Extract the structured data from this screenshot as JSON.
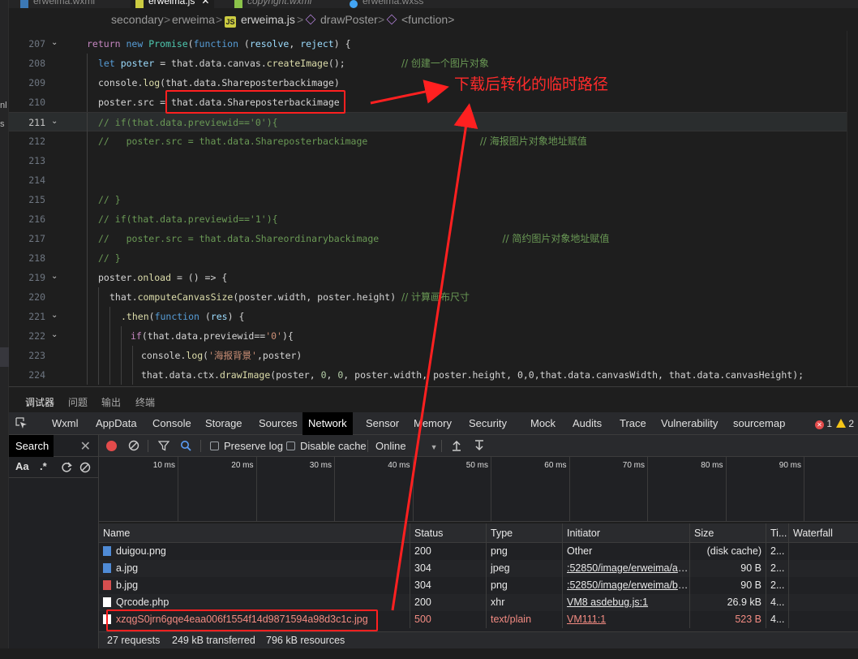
{
  "tabs": [
    {
      "label": "erweima.wxml",
      "active": false
    },
    {
      "label": "erweima.js",
      "active": true
    },
    {
      "label": "copyright.wxml",
      "active": false
    },
    {
      "label": "erweima.wxss",
      "active": false
    }
  ],
  "breadcrumb": {
    "seg1": "secondary",
    "seg2": "erweima",
    "file": "erweima.js",
    "fn1": "drawPoster",
    "fn2": "<function>",
    "js_badge": "JS",
    "sep": ">"
  },
  "left_fragments": [
    "nl",
    "s"
  ],
  "editor": {
    "lines": [
      {
        "n": "207",
        "fold": true
      },
      {
        "n": "208",
        "fold": false
      },
      {
        "n": "209",
        "fold": false
      },
      {
        "n": "210",
        "fold": false
      },
      {
        "n": "211",
        "fold": true,
        "current": true
      },
      {
        "n": "212",
        "fold": false
      },
      {
        "n": "213",
        "fold": false
      },
      {
        "n": "214",
        "fold": false
      },
      {
        "n": "215",
        "fold": false
      },
      {
        "n": "216",
        "fold": false
      },
      {
        "n": "217",
        "fold": false
      },
      {
        "n": "218",
        "fold": false
      },
      {
        "n": "219",
        "fold": true
      },
      {
        "n": "220",
        "fold": false
      },
      {
        "n": "221",
        "fold": true
      },
      {
        "n": "222",
        "fold": true
      },
      {
        "n": "223",
        "fold": false
      },
      {
        "n": "224",
        "fold": false
      }
    ],
    "text": {
      "l207_return": "return",
      "l207_new": "new",
      "l207_promise": "Promise",
      "l207_function": "function",
      "l207_resolve": "resolve",
      "l207_reject": "reject",
      "l208_let": "let",
      "l208_poster": "poster",
      "l208_that": "that.data.canvas.",
      "l208_create": "createImage",
      "l208_cm": "// 创建一个图片对象",
      "l209_console": "console.",
      "l209_log": "log",
      "l209_arg": "that.data.Shareposterbackimage",
      "l210_lhs": "poster.src = ",
      "l210_rhs": "that.data.Shareposterbackimage",
      "l211": "// if(that.data.previewid=='0'){",
      "l212_a": "//   poster.src = that.data.Shareposterbackimage",
      "l212_cm": "// 海报图片对象地址赋值",
      "l215": "// }",
      "l216": "// if(that.data.previewid=='1'){",
      "l217_a": "//   poster.src = that.data.Shareordinarybackimage",
      "l217_cm": "// 简约图片对象地址赋值",
      "l218": "// }",
      "l219_a": "poster.",
      "l219_onload": "onload",
      "l219_b": " = () => {",
      "l220_that": "that.",
      "l220_fn": "computeCanvasSize",
      "l220_args": "(poster.width, poster.height) ",
      "l220_cm": "// 计算画布尺寸",
      "l221_then": ".then",
      "l221_function": "function",
      "l221_res": "res",
      "l222_if": "if",
      "l222_cond": "(that.data.previewid==",
      "l222_str": "'0'",
      "l222_end": "){",
      "l223_console": "console.",
      "l223_log": "log",
      "l223_str": "'海报背景'",
      "l223_end": ",poster)",
      "l224_a": "that.data.ctx.",
      "l224_fn": "drawImage",
      "l224_b": "(poster, ",
      "l224_n1": "0",
      "l224_n2": "0",
      "l224_c": ", poster.width, poster.height, ",
      "l224_d": "0,0",
      "l224_e": ",that.data.canvasWidth, that.data.canvasHeight);"
    }
  },
  "panel_tabs": [
    "调试器",
    "问题",
    "输出",
    "终端"
  ],
  "devtools_tabs": [
    "Wxml",
    "AppData",
    "Console",
    "Storage",
    "Sources",
    "Network",
    "Sensor",
    "Memory",
    "Security",
    "Mock",
    "Audits",
    "Trace",
    "Vulnerability",
    "sourcemap"
  ],
  "devtools_active": "Network",
  "errors_count": "1",
  "warnings_count": "2",
  "search_pane": {
    "title": "Search",
    "close": "✕",
    "aa": "Aa",
    "regex": ".*"
  },
  "net_toolbar": {
    "preserve_log": "Preserve log",
    "disable_cache": "Disable cache",
    "throttle": "Online"
  },
  "overview_ticks": [
    "10 ms",
    "20 ms",
    "30 ms",
    "40 ms",
    "50 ms",
    "60 ms",
    "70 ms",
    "80 ms",
    "90 ms"
  ],
  "table": {
    "headers": [
      "Name",
      "Status",
      "Type",
      "Initiator",
      "Size",
      "Ti...",
      "Waterfall"
    ],
    "rows": [
      {
        "name": "duigou.png",
        "status": "200",
        "type": "png",
        "initiator": "Other",
        "size": "(disk cache)",
        "time": "2...",
        "icon_color": "#4f8bd6"
      },
      {
        "name": "a.jpg",
        "status": "304",
        "type": "jpeg",
        "initiator": ":52850/image/erweima/a.j...",
        "size": "90 B",
        "time": "2...",
        "icon_color": "#4f8bd6"
      },
      {
        "name": "b.jpg",
        "status": "304",
        "type": "png",
        "initiator": ":52850/image/erweima/b.j...",
        "size": "90 B",
        "time": "2...",
        "icon_color": "#d64f4f"
      },
      {
        "name": "Qrcode.php",
        "status": "200",
        "type": "xhr",
        "initiator": "VM8 asdebug.js:1",
        "size": "26.9 kB",
        "time": "4...",
        "icon_color": "#ffffff"
      },
      {
        "name": "xzqgS0jrn6gqe4eaa006f1554f14d9871594a98d3c1c.jpg",
        "status": "500",
        "type": "text/plain",
        "initiator": "VM111:1",
        "size": "523 B",
        "time": "4...",
        "icon_color": "#ffffff",
        "error": true
      }
    ]
  },
  "status_bar": {
    "requests": "27 requests",
    "transferred": "249 kB transferred",
    "resources": "796 kB resources"
  },
  "annotation": {
    "note": "下载后转化的临时路径",
    "color": "#ff2020"
  },
  "colors": {
    "editor_bg": "#1e1e1e",
    "accent_red": "#ff2020",
    "comment": "#6a9955",
    "keyword": "#569cd6"
  }
}
